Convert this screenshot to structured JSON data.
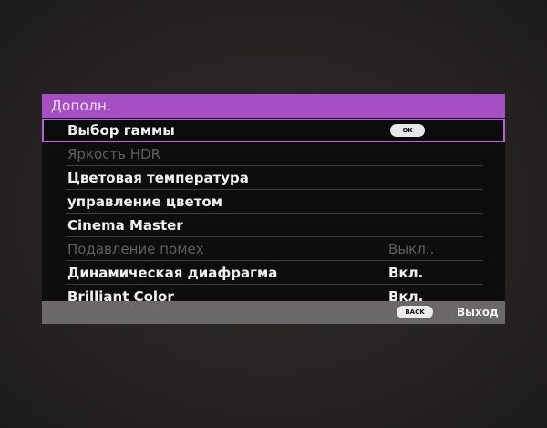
{
  "osd": {
    "title": "Дополн.",
    "items": [
      {
        "label": "Выбор гаммы",
        "value": "",
        "selected": true,
        "disabled": false,
        "action": "OK"
      },
      {
        "label": "Яркость HDR",
        "value": "",
        "selected": false,
        "disabled": true
      },
      {
        "label": "Цветовая температура",
        "value": "",
        "selected": false,
        "disabled": false
      },
      {
        "label": "управление цветом",
        "value": "",
        "selected": false,
        "disabled": false
      },
      {
        "label": "Cinema Master",
        "value": "",
        "selected": false,
        "disabled": false
      },
      {
        "label": "Подавление помех",
        "value": "Выкл..",
        "selected": false,
        "disabled": true
      },
      {
        "label": "Динамическая диафрагма",
        "value": "Вкл.",
        "selected": false,
        "disabled": false
      },
      {
        "label": "Brilliant Color",
        "value": "Вкл.",
        "selected": false,
        "disabled": false
      }
    ],
    "footer": {
      "back_button": "BACK",
      "exit_label": "Выход"
    }
  },
  "colors": {
    "header": "#a64fc4",
    "selection_border": "#b364d3",
    "panel": "#0d0d0d",
    "footer": "#6a6967"
  }
}
